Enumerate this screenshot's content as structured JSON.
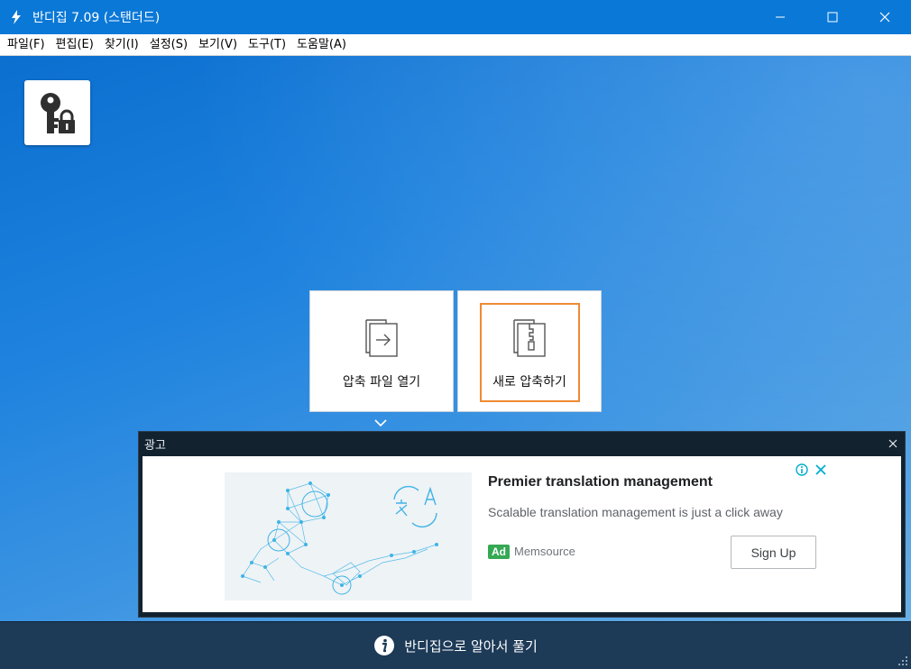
{
  "window": {
    "title": "반디집 7.09 (스탠더드)"
  },
  "menu": [
    "파일(F)",
    "편집(E)",
    "찾기(I)",
    "설정(S)",
    "보기(V)",
    "도구(T)",
    "도움말(A)"
  ],
  "actions": {
    "open_label": "압축 파일 열기",
    "new_label": "새로 압축하기"
  },
  "ad": {
    "header": "광고",
    "title": "Premier translation management",
    "description": "Scalable translation management is just a click away",
    "badge": "Ad",
    "source": "Memsource",
    "cta": "Sign Up"
  },
  "footer": {
    "label": "반디집으로 알아서 풀기"
  },
  "colors": {
    "titlebar": "#0a78d7",
    "highlight_border": "#f08a33",
    "ad_panel": "#13222f",
    "footer": "#1d3a57"
  }
}
